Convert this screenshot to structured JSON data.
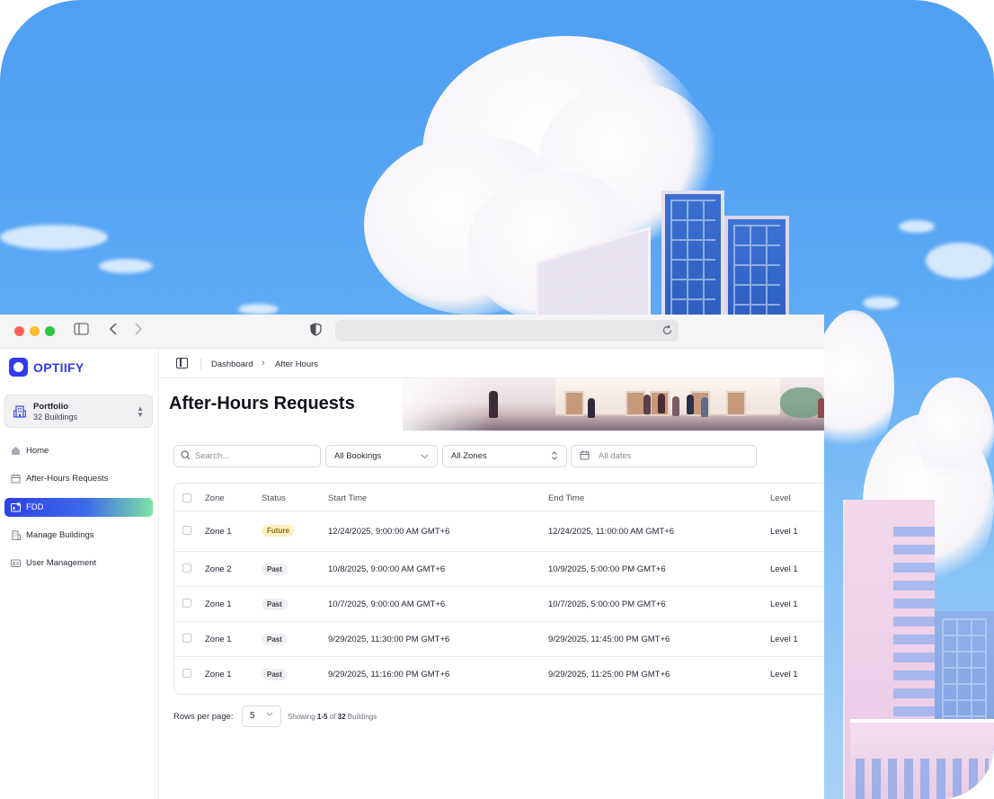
{
  "brand": {
    "name": "OPTIIFY",
    "accent": "#2f3bf1"
  },
  "portfolio": {
    "title": "Portfolio",
    "subtitle": "32 Buildings"
  },
  "nav": [
    {
      "label": "Home",
      "icon": "home-icon"
    },
    {
      "label": "After-Hours Requests",
      "icon": "calendar-icon"
    },
    {
      "label": "FDD",
      "icon": "fdd-icon",
      "active": true
    },
    {
      "label": "Manage Buildings",
      "icon": "building-icon"
    },
    {
      "label": "User Management",
      "icon": "user-card-icon"
    }
  ],
  "breadcrumb": {
    "parent": "Dashboard",
    "current": "After Hours"
  },
  "page": {
    "title": "After-Hours Requests"
  },
  "filters": {
    "search_placeholder": "Search...",
    "bookings": "All Bookings",
    "zones": "All Zones",
    "dates_placeholder": "All dates"
  },
  "table": {
    "columns": [
      "Zone",
      "Status",
      "Start Time",
      "End Time",
      "Level"
    ],
    "rows": [
      {
        "zone": "Zone 1",
        "status": "Future",
        "start": "12/24/2025, 9:00:00 AM GMT+6",
        "end": "12/24/2025, 11:00:00 AM GMT+6",
        "level": "Level 1"
      },
      {
        "zone": "Zone 2",
        "status": "Past",
        "start": "10/8/2025, 9:00:00 AM GMT+6",
        "end": "10/9/2025, 5:00:00 PM GMT+6",
        "level": "Level 1"
      },
      {
        "zone": "Zone 1",
        "status": "Past",
        "start": "10/7/2025, 9:00:00 AM GMT+6",
        "end": "10/7/2025, 5:00:00 PM GMT+6",
        "level": "Level 1"
      },
      {
        "zone": "Zone 1",
        "status": "Past",
        "start": "9/29/2025, 11:30:00 PM GMT+6",
        "end": "9/29/2025, 11:45:00 PM GMT+6",
        "level": "Level 1"
      },
      {
        "zone": "Zone 1",
        "status": "Past",
        "start": "9/29/2025, 11:16:00 PM GMT+6",
        "end": "9/29/2025, 11:25:00 PM GMT+6",
        "level": "Level 1"
      }
    ]
  },
  "pagination": {
    "rows_label": "Rows per page:",
    "rows_value": "5",
    "showing_prefix": "Showing",
    "range": "1-5",
    "of": "of",
    "total": "32",
    "unit": "Buildings"
  }
}
